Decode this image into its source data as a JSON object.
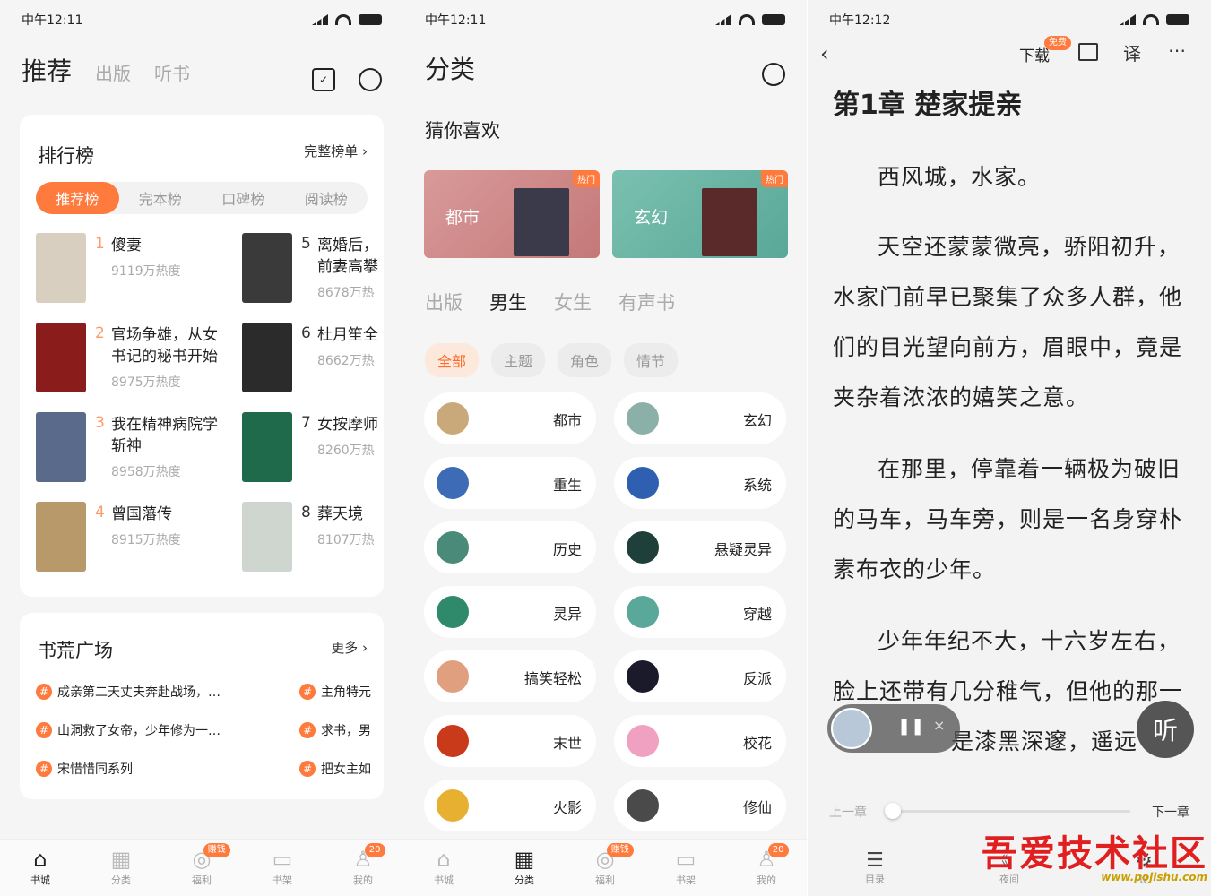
{
  "colors": {
    "accent": "#ff7a3d",
    "text": "#222222",
    "muted": "#aaaaaa"
  },
  "p1": {
    "status_time": "中午12:11",
    "nav_tabs": [
      "推荐",
      "出版",
      "听书"
    ],
    "rank": {
      "title": "排行榜",
      "more": "完整榜单 ›",
      "chips": [
        "推荐榜",
        "完本榜",
        "口碑榜",
        "阅读榜"
      ],
      "items": [
        {
          "num": "1",
          "title": "傻妻",
          "heat": "9119万热度",
          "cover": "#d8cfc0"
        },
        {
          "num": "5",
          "title": "离婚后，\n前妻高攀",
          "heat": "8678万热",
          "cover": "#3a3a3a"
        },
        {
          "num": "2",
          "title": "官场争雄，从女\n书记的秘书开始",
          "heat": "8975万热度",
          "cover": "#8a1c1c"
        },
        {
          "num": "6",
          "title": "杜月笙全",
          "heat": "8662万热",
          "cover": "#2b2b2b"
        },
        {
          "num": "3",
          "title": "我在精神病院学\n斩神",
          "heat": "8958万热度",
          "cover": "#5a6a8a"
        },
        {
          "num": "7",
          "title": "女按摩师",
          "heat": "8260万热",
          "cover": "#1f6a4a"
        },
        {
          "num": "4",
          "title": "曾国藩传",
          "heat": "8915万热度",
          "cover": "#b89a6a"
        },
        {
          "num": "8",
          "title": "葬天境",
          "heat": "8107万热",
          "cover": "#cfd6d0"
        }
      ]
    },
    "plaza": {
      "title": "书荒广场",
      "more": "更多 ›",
      "left": [
        "成亲第二天丈夫奔赴战场，…",
        "山洞救了女帝，少年修为一…",
        "宋惜惜同系列"
      ],
      "right": [
        "主角特元",
        "求书，男",
        "把女主如"
      ],
      "hash": "#"
    },
    "tabbar": [
      {
        "label": "书城"
      },
      {
        "label": "分类"
      },
      {
        "label": "福利",
        "badge": "赚钱"
      },
      {
        "label": "书架"
      },
      {
        "label": "我的",
        "badge": "20"
      }
    ]
  },
  "p2": {
    "status_time": "中午12:11",
    "title": "分类",
    "guess": "猜你喜欢",
    "banners": [
      {
        "label": "都市",
        "tag": "热门"
      },
      {
        "label": "玄幻",
        "tag": "热门"
      }
    ],
    "section_tabs": [
      "出版",
      "男生",
      "女生",
      "有声书"
    ],
    "filters": [
      "全部",
      "主题",
      "角色",
      "情节"
    ],
    "cats": [
      {
        "label": "都市",
        "color": "#c9a87a"
      },
      {
        "label": "玄幻",
        "color": "#8ab0a8"
      },
      {
        "label": "重生",
        "color": "#3d6bb5"
      },
      {
        "label": "系统",
        "color": "#2e5fb0"
      },
      {
        "label": "历史",
        "color": "#4a8a78"
      },
      {
        "label": "悬疑灵异",
        "color": "#1f3f3a"
      },
      {
        "label": "灵异",
        "color": "#2e8a6a"
      },
      {
        "label": "穿越",
        "color": "#5aa89a"
      },
      {
        "label": "搞笑轻松",
        "color": "#e0a080"
      },
      {
        "label": "反派",
        "color": "#1a1a2a"
      },
      {
        "label": "末世",
        "color": "#c83a1a"
      },
      {
        "label": "校花",
        "color": "#f0a0c0"
      },
      {
        "label": "火影",
        "color": "#e8b030"
      },
      {
        "label": "修仙",
        "color": "#4a4a4a"
      }
    ],
    "tabbar": [
      {
        "label": "书城"
      },
      {
        "label": "分类"
      },
      {
        "label": "福利",
        "badge": "赚钱"
      },
      {
        "label": "书架"
      },
      {
        "label": "我的",
        "badge": "20"
      }
    ]
  },
  "p3": {
    "status_time": "中午12:12",
    "download": "下载",
    "free": "免费",
    "chapter": "第1章 楚家提亲",
    "paragraphs": [
      "西风城，水家。",
      "天空还蒙蒙微亮，骄阳初升，水家门前早已聚集了众多人群，他们的目光望向前方，眉眼中，竟是夹杂着浓浓的嬉笑之意。",
      "在那里，停靠着一辆极为破旧的马车，马车旁，则是一名身穿朴素布衣的少年。",
      "少年年纪不大，十六岁左右，脸上还带有几分稚气，但他的那一",
      "是漆黑深邃，遥远"
    ],
    "listen": "听",
    "prev": "上一章",
    "next": "下一章",
    "bottom": [
      {
        "label": "目录"
      },
      {
        "label": "夜间"
      },
      {
        "label": "设"
      }
    ],
    "watermark": "吾爱技术社区",
    "watermark_url": "www.pojishu.com"
  }
}
